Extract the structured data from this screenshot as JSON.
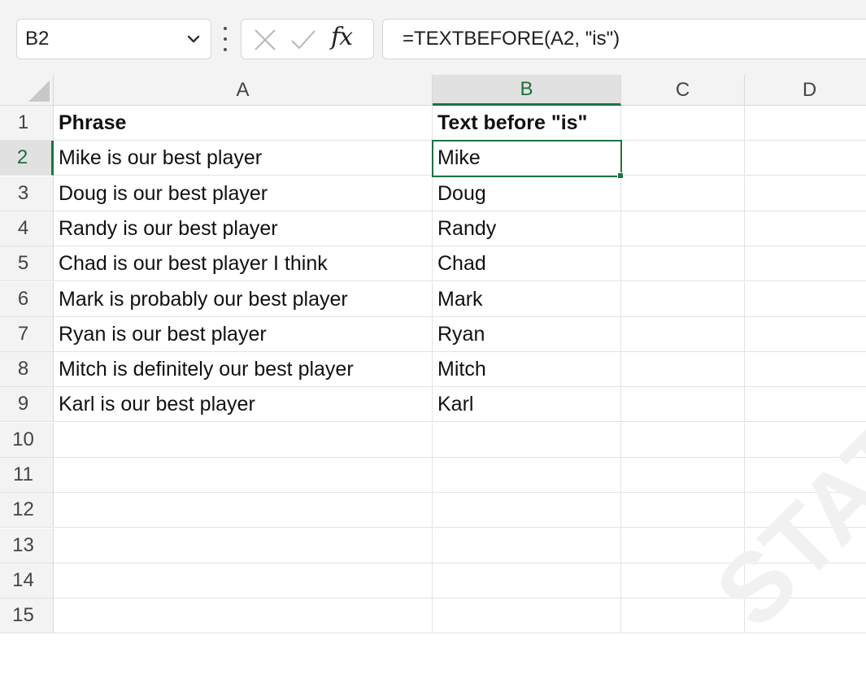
{
  "formula_bar": {
    "name_box": "B2",
    "formula": "=TEXTBEFORE(A2, \"is\")"
  },
  "columns": [
    "A",
    "B",
    "C",
    "D"
  ],
  "active_column": "B",
  "active_row": "2",
  "rows": [
    {
      "num": "1",
      "a": "Phrase",
      "b": "Text before \"is\""
    },
    {
      "num": "2",
      "a": "Mike is our best player",
      "b": "Mike"
    },
    {
      "num": "3",
      "a": "Doug is our best player",
      "b": "Doug"
    },
    {
      "num": "4",
      "a": "Randy is our best player",
      "b": "Randy"
    },
    {
      "num": "5",
      "a": "Chad is our best player I think",
      "b": "Chad"
    },
    {
      "num": "6",
      "a": "Mark is probably our best player",
      "b": "Mark"
    },
    {
      "num": "7",
      "a": "Ryan is our best player",
      "b": "Ryan"
    },
    {
      "num": "8",
      "a": "Mitch is definitely our best player",
      "b": "Mitch"
    },
    {
      "num": "9",
      "a": "Karl is our best player",
      "b": "Karl"
    },
    {
      "num": "10",
      "a": "",
      "b": ""
    },
    {
      "num": "11",
      "a": "",
      "b": ""
    },
    {
      "num": "12",
      "a": "",
      "b": ""
    },
    {
      "num": "13",
      "a": "",
      "b": ""
    },
    {
      "num": "14",
      "a": "",
      "b": ""
    },
    {
      "num": "15",
      "a": "",
      "b": ""
    }
  ],
  "watermark": "STATOLOGY.ORG",
  "colors": {
    "accent": "#1e7145",
    "header_bg": "#f3f3f3",
    "gridline": "#e3e3e3"
  }
}
